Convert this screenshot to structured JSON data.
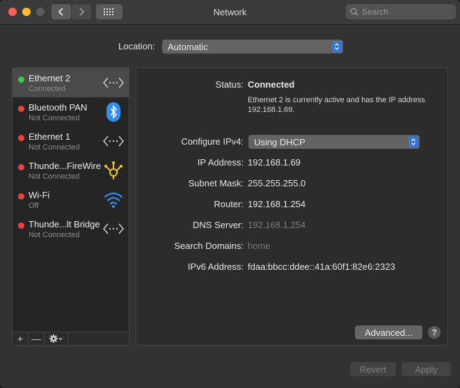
{
  "window": {
    "title": "Network",
    "search_placeholder": "Search"
  },
  "location": {
    "label": "Location:",
    "value": "Automatic"
  },
  "services": [
    {
      "name": "Ethernet 2",
      "status": "Connected",
      "dot_color": "#3ec84a",
      "icon": "ethernet-icon",
      "selected": true
    },
    {
      "name": "Bluetooth PAN",
      "status": "Not Connected",
      "dot_color": "#e8463f",
      "icon": "bluetooth-icon"
    },
    {
      "name": "Ethernet 1",
      "status": "Not Connected",
      "dot_color": "#e8463f",
      "icon": "ethernet-icon"
    },
    {
      "name": "Thunde...FireWire",
      "status": "Not Connected",
      "dot_color": "#e8463f",
      "icon": "firewire-icon"
    },
    {
      "name": "Wi-Fi",
      "status": "Off",
      "dot_color": "#e8463f",
      "icon": "wifi-icon"
    },
    {
      "name": "Thunde...lt Bridge",
      "status": "Not Connected",
      "dot_color": "#e8463f",
      "icon": "ethernet-icon"
    }
  ],
  "detail": {
    "status_label": "Status:",
    "status_value": "Connected",
    "status_desc": "Ethernet 2 is currently active and has the IP address 192.168.1.69.",
    "configure_label": "Configure IPv4:",
    "configure_value": "Using DHCP",
    "ip_label": "IP Address:",
    "ip_value": "192.168.1.69",
    "subnet_label": "Subnet Mask:",
    "subnet_value": "255.255.255.0",
    "router_label": "Router:",
    "router_value": "192.168.1.254",
    "dns_label": "DNS Server:",
    "dns_value": "192.168.1.254",
    "search_domains_label": "Search Domains:",
    "search_domains_value": "home",
    "ipv6_label": "IPv6 Address:",
    "ipv6_value": "fdaa:bbcc:ddee::41a:60f1:82e6:2323"
  },
  "buttons": {
    "advanced": "Advanced...",
    "help": "?",
    "revert": "Revert",
    "apply": "Apply",
    "add": "+",
    "remove": "—"
  },
  "colors": {
    "accent": "#3875d7",
    "connected": "#3ec84a",
    "disconnected": "#e8463f"
  }
}
